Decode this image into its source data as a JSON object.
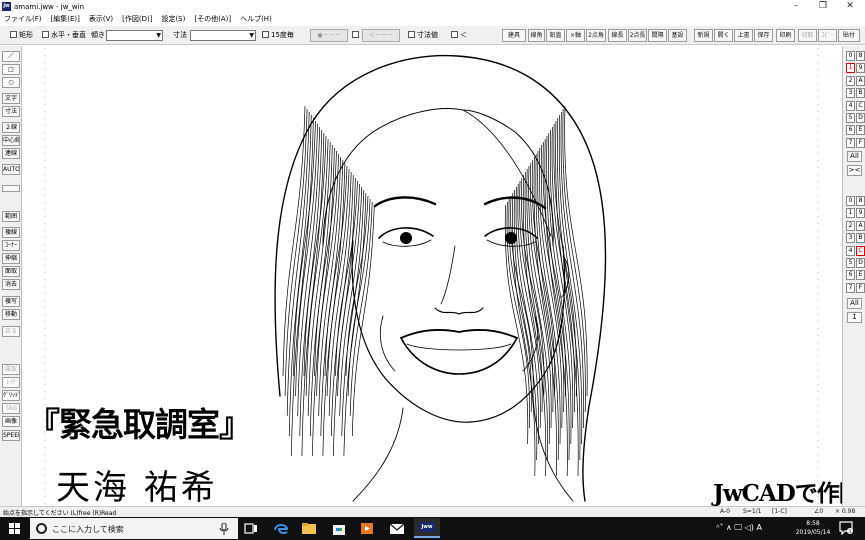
{
  "window": {
    "title": "amami.jww - jw_win",
    "app_icon_label": "jw",
    "controls": [
      "minimize-icon",
      "restore-icon",
      "close-icon"
    ]
  },
  "menu": [
    "ファイル(F)",
    "[編集(E)]",
    "表示(V)",
    "[作図(D)]",
    "設定(S)",
    "[その他(A)]",
    "ヘルプ(H)"
  ],
  "toolbar": {
    "rect_label": "矩形",
    "hv_label": "水平・垂直",
    "slope_label": "傾き",
    "dim_label": "寸法",
    "deg15_label": "15度毎",
    "dash_label": "●－－－",
    "arrow_label": "＜－－－",
    "dimval_label": "寸法値",
    "lt_label": "＜",
    "buttons": [
      "建具",
      "線角",
      "鉛直",
      "×軸",
      "2点角",
      "線長",
      "2点長",
      "間隔",
      "基設",
      "新規",
      "開く",
      "上書",
      "保存",
      "印刷",
      "切取",
      "ｺﾋﾟｰ",
      "貼付"
    ],
    "disabled_buttons": [
      "切取",
      "ｺﾋﾟｰ"
    ]
  },
  "left_tools": [
    {
      "label": "／",
      "enabled": true
    },
    {
      "label": "□",
      "enabled": true
    },
    {
      "label": "○",
      "enabled": true
    },
    {
      "label": "文字",
      "enabled": true
    },
    {
      "label": "寸法",
      "enabled": true
    },
    {
      "label": "２線",
      "enabled": true
    },
    {
      "label": "中心線",
      "enabled": true
    },
    {
      "label": "連線",
      "enabled": true
    },
    {
      "label": "AUTO",
      "enabled": true
    },
    {
      "label": "",
      "enabled": true
    },
    {
      "label": "範囲",
      "enabled": true
    },
    {
      "label": "複線",
      "enabled": true
    },
    {
      "label": "ｺｰﾅｰ",
      "enabled": true
    },
    {
      "label": "伸縮",
      "enabled": true
    },
    {
      "label": "面取",
      "enabled": true
    },
    {
      "label": "消去",
      "enabled": true
    },
    {
      "label": "複写",
      "enabled": true
    },
    {
      "label": "移動",
      "enabled": true
    },
    {
      "label": "戻る",
      "enabled": false
    },
    {
      "label": "属取",
      "enabled": false
    },
    {
      "label": "ﾚｲﾔ",
      "enabled": false
    },
    {
      "label": "ｸﾞﾘｯﾄﾞ",
      "enabled": true
    },
    {
      "label": "TAG",
      "enabled": false
    },
    {
      "label": "画像",
      "enabled": true
    },
    {
      "label": "SPEED",
      "enabled": true
    }
  ],
  "layers_top": {
    "cells": [
      "0",
      "8",
      "1",
      "9",
      "2",
      "A",
      "3",
      "B",
      "4",
      "C",
      "5",
      "D",
      "6",
      "E",
      "7",
      "F"
    ],
    "selected": "1",
    "all_label": "All",
    "x_label": "><"
  },
  "layers_bottom": {
    "cells": [
      "0",
      "8",
      "1",
      "9",
      "2",
      "A",
      "3",
      "B",
      "4",
      "C",
      "5",
      "D",
      "6",
      "E",
      "7",
      "F"
    ],
    "selected": "C",
    "all_label": "All",
    "one_label": "1"
  },
  "canvas": {
    "caption_drama": "『緊急取調室』",
    "caption_name": "天海 祐希",
    "caption_brand": "JwCADで作図"
  },
  "status": {
    "message": "始点を指示してください (L)free (R)Read",
    "cells": [
      "A-0",
      "S=1/1",
      "[1-C]",
      "∠0",
      "× 0.98"
    ]
  },
  "taskbar": {
    "search_placeholder": "ここに入力して検索",
    "apps": [
      "task-view-icon",
      "edge-icon",
      "explorer-icon",
      "store-icon",
      "media-icon",
      "mail-icon",
      "jwcad-icon"
    ],
    "active_app_label": "Jww",
    "tray": "ᴬ˅ ∧ 🖵 ◁) A",
    "time": "8:58",
    "date": "2019/05/14",
    "notification_count": "1"
  },
  "colors": {
    "taskbar_bg": "#101010",
    "active_app": "#1a2a6c",
    "selected_layer": "#dd0000"
  }
}
